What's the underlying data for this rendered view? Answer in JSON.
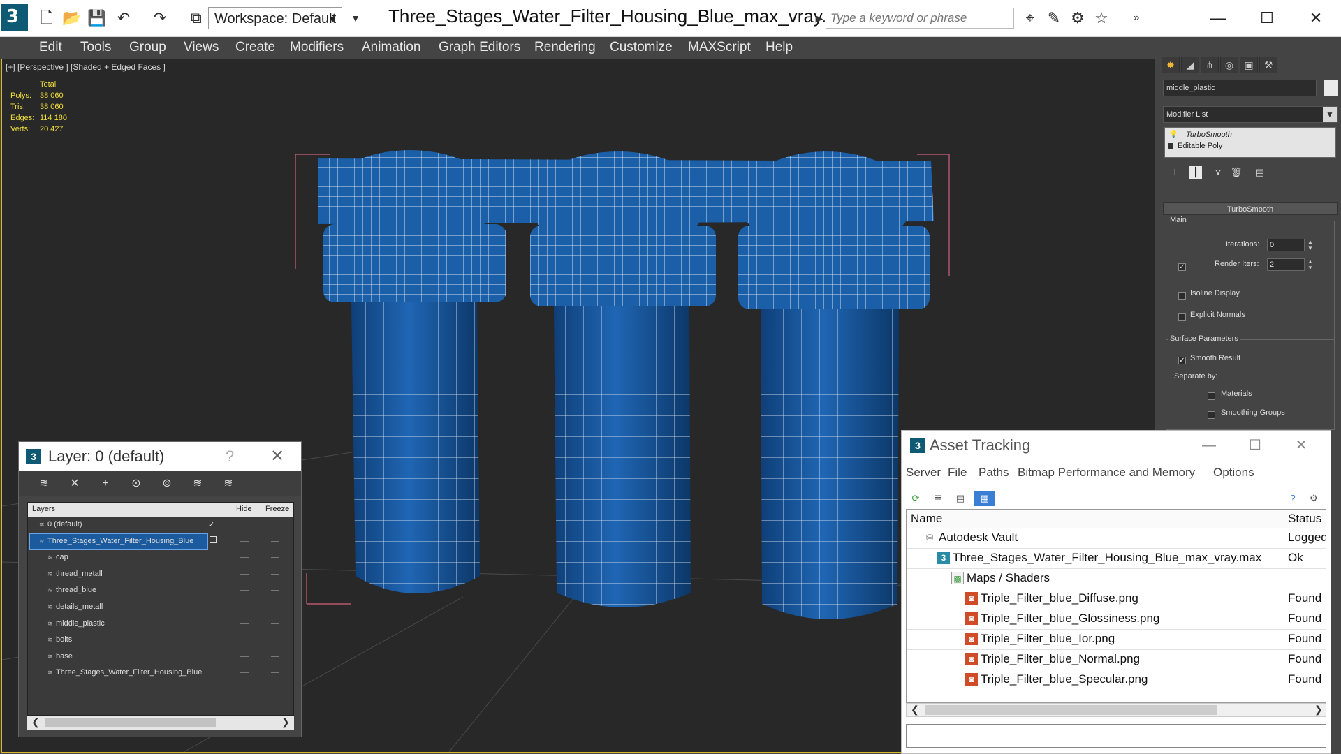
{
  "titlebar": {
    "workspace": "Workspace: Default",
    "document_title": "Three_Stages_Water_Filter_Housing_Blue_max_vray.max",
    "search_placeholder": "Type a keyword or phrase"
  },
  "menu": [
    "Edit",
    "Tools",
    "Group",
    "Views",
    "Create",
    "Modifiers",
    "Animation",
    "Graph Editors",
    "Rendering",
    "Customize",
    "MAXScript",
    "Help"
  ],
  "viewport": {
    "label": "[+] [Perspective ] [Shaded + Edged Faces ]",
    "stats_header": "Total",
    "stats": [
      {
        "k": "Polys:",
        "v": "38 060"
      },
      {
        "k": "Tris:",
        "v": "38 060"
      },
      {
        "k": "Edges:",
        "v": "114 180"
      },
      {
        "k": "Verts:",
        "v": "20 427"
      }
    ]
  },
  "command_panel": {
    "object_name": "middle_plastic",
    "modifier_list": "Modifier List",
    "stack": [
      "TurboSmooth",
      "Editable Poly"
    ],
    "rollout_title": "TurboSmooth",
    "group_main": "Main",
    "iterations_label": "Iterations:",
    "iterations_value": "0",
    "render_iters_label": "Render Iters:",
    "render_iters_value": "2",
    "isoline_label": "Isoline Display",
    "explicit_normals_label": "Explicit Normals",
    "group_surface": "Surface Parameters",
    "smooth_result_label": "Smooth Result",
    "separate_by_label": "Separate by:",
    "materials_label": "Materials",
    "smoothing_groups_label": "Smoothing Groups"
  },
  "layer_dialog": {
    "title": "Layer: 0 (default)",
    "help": "?",
    "columns": {
      "layers": "Layers",
      "hide": "Hide",
      "freeze": "Freeze"
    },
    "rows": [
      {
        "name": "0 (default)",
        "indent": 1
      },
      {
        "name": "Three_Stages_Water_Filter_Housing_Blue",
        "indent": 1
      },
      {
        "name": "cap",
        "indent": 2
      },
      {
        "name": "thread_metall",
        "indent": 2
      },
      {
        "name": "thread_blue",
        "indent": 2
      },
      {
        "name": "details_metall",
        "indent": 2
      },
      {
        "name": "middle_plastic",
        "indent": 2
      },
      {
        "name": "bolts",
        "indent": 2
      },
      {
        "name": "base",
        "indent": 2
      },
      {
        "name": "Three_Stages_Water_Filter_Housing_Blue",
        "indent": 2
      }
    ]
  },
  "asset_tracking": {
    "title": "Asset Tracking",
    "menu": [
      "Server",
      "File",
      "Paths",
      "Bitmap Performance and Memory",
      "Options"
    ],
    "columns": {
      "name": "Name",
      "status": "Status"
    },
    "rows": [
      {
        "name": "Autodesk Vault",
        "status": "Logged",
        "level": 1,
        "icon": "vault-icon"
      },
      {
        "name": "Three_Stages_Water_Filter_Housing_Blue_max_vray.max",
        "status": "Ok",
        "level": 2,
        "icon": "max-file-icon"
      },
      {
        "name": "Maps / Shaders",
        "status": "",
        "level": 3,
        "icon": "folder-icon"
      },
      {
        "name": "Triple_Filter_blue_Diffuse.png",
        "status": "Found",
        "level": 4,
        "icon": "png-icon"
      },
      {
        "name": "Triple_Filter_blue_Glossiness.png",
        "status": "Found",
        "level": 4,
        "icon": "png-icon"
      },
      {
        "name": "Triple_Filter_blue_Ior.png",
        "status": "Found",
        "level": 4,
        "icon": "png-icon"
      },
      {
        "name": "Triple_Filter_blue_Normal.png",
        "status": "Found",
        "level": 4,
        "icon": "png-icon"
      },
      {
        "name": "Triple_Filter_blue_Specular.png",
        "status": "Found",
        "level": 4,
        "icon": "png-icon"
      }
    ]
  },
  "colors": {
    "viewport_bg": "#282828",
    "filter_blue": "#1a5fa8",
    "wire": "#e8eef8",
    "stats": "#f0de3c",
    "selection": "#1c5a9e"
  }
}
